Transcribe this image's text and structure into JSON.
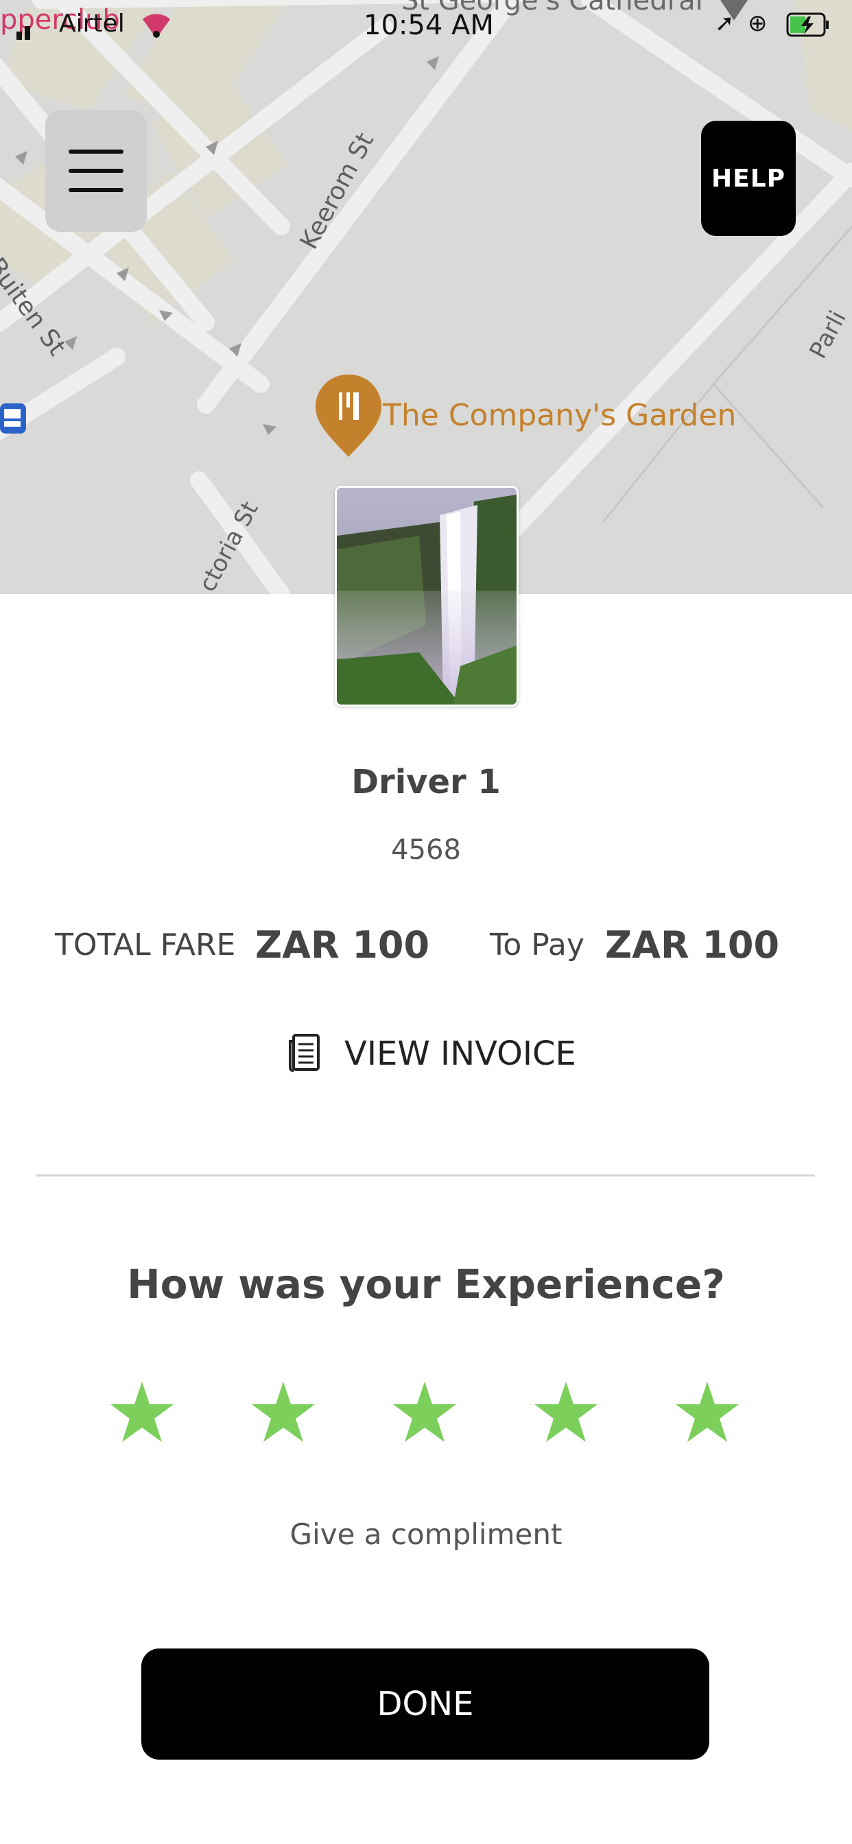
{
  "status_bar": {
    "overlay_text": "pperclub",
    "carrier": "Airtel",
    "time": "10:54 AM"
  },
  "map": {
    "labels": {
      "cathedral": "St George's Cathedral",
      "keerom": "Keerom St",
      "buiten": "Buiten St",
      "victoria": "ctoria St",
      "parli": "Parli",
      "garden": "The Company's Garden"
    },
    "accent_color": "#c4812c",
    "bus_icon_color": "#2c63c9"
  },
  "header": {
    "menu_icon": "hamburger-menu-icon",
    "help_label": "HELP"
  },
  "driver": {
    "name": "Driver 1",
    "id": "4568"
  },
  "fare": {
    "total_label": "TOTAL FARE",
    "total_value": "ZAR 100",
    "to_pay_label": "To Pay",
    "to_pay_value": "ZAR 100"
  },
  "invoice": {
    "label": "VIEW INVOICE",
    "icon": "invoice-document-icon"
  },
  "rating": {
    "title": "How was your Experience?",
    "stars_filled": 5,
    "stars_total": 5,
    "star_color": "#7bcf5a",
    "compliment_label": "Give a compliment"
  },
  "actions": {
    "done_label": "DONE"
  }
}
